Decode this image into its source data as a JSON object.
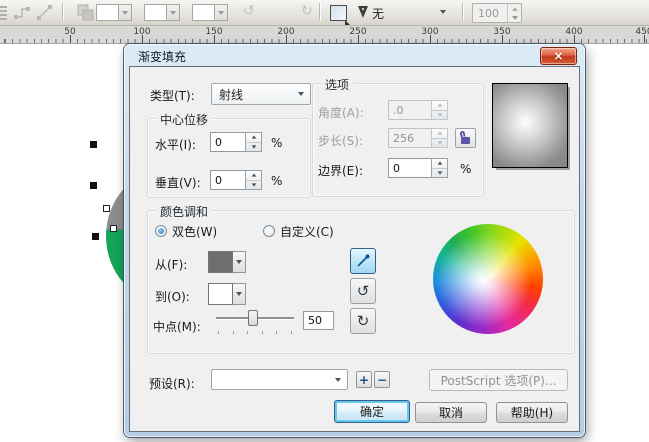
{
  "colors": {
    "accent_blue": "#2c628b",
    "from_color": "#6e6e6e",
    "to_color": "#ffffff",
    "object_green": "#14a457",
    "object_gray": "#8e8e8e",
    "close_red": "#c33b1e"
  },
  "toolbar": {
    "outline_width_value": "无",
    "zoom_value": "100"
  },
  "ruler": {
    "labels": [
      "50",
      "100",
      "150",
      "200",
      "250",
      "300",
      "350",
      "400",
      "450"
    ]
  },
  "dialog": {
    "title": "渐变填充",
    "type_label": "类型(T):",
    "type_value": "射线",
    "center_offset": {
      "group_label": "中心位移",
      "horizontal_label": "水平(I):",
      "horizontal_value": "0",
      "horizontal_unit": "%",
      "vertical_label": "垂直(V):",
      "vertical_value": "0",
      "vertical_unit": "%"
    },
    "options": {
      "group_label": "选项",
      "angle_label": "角度(A):",
      "angle_value": ".0",
      "steps_label": "步长(S):",
      "steps_value": "256",
      "edge_label": "边界(E):",
      "edge_value": "0",
      "edge_unit": "%"
    },
    "color_blend": {
      "group_label": "颜色调和",
      "two_color_label": "双色(W)",
      "custom_label": "自定义(C)",
      "from_label": "从(F):",
      "to_label": "到(O):",
      "midpoint_label": "中点(M):",
      "midpoint_value": "50"
    },
    "presets_label": "预设(R):",
    "presets_value": "",
    "postscript_label": "PostScript 选项(P)...",
    "ok_label": "确定",
    "cancel_label": "取消",
    "help_label": "帮助(H)"
  },
  "icons": {
    "close": "×",
    "rotate_ccw": "↺",
    "rotate_cw": "↻",
    "plus": "+",
    "minus": "−"
  }
}
